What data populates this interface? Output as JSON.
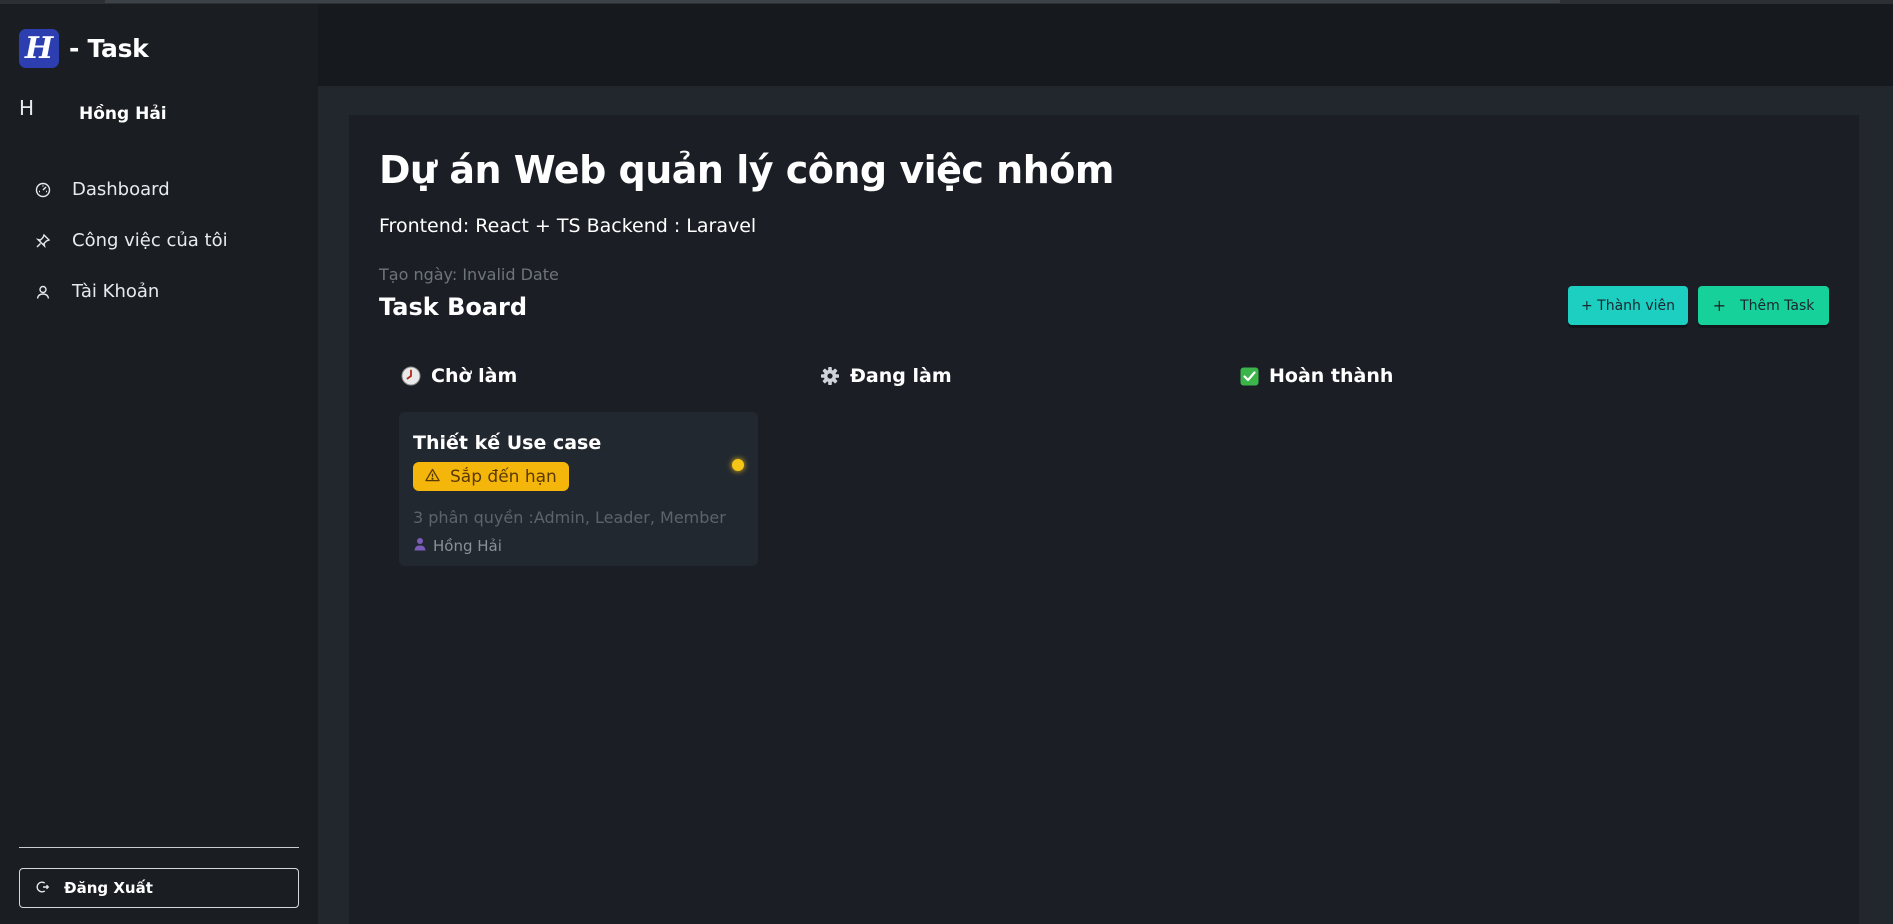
{
  "app": {
    "logo_letter": "H",
    "title": "- Task",
    "accent_color": "#2d3fb0"
  },
  "user": {
    "initial": "H",
    "name": "Hồng Hải"
  },
  "sidebar": {
    "items": [
      {
        "label": "Dashboard",
        "icon": "gauge-icon"
      },
      {
        "label": "Công việc của tôi",
        "icon": "pin-icon"
      },
      {
        "label": "Tài Khoản",
        "icon": "user-icon"
      }
    ],
    "logout_label": "Đăng Xuất",
    "logout_icon": "logout-icon"
  },
  "project": {
    "title": "Dự án Web quản lý công việc nhóm",
    "description": "Frontend: React + TS Backend : Laravel",
    "created": "Tạo ngày: Invalid Date"
  },
  "board": {
    "title": "Task Board",
    "add_member_label": "+ Thành viên",
    "add_task_label": "Thêm Task",
    "add_task_icon": "+",
    "member_button_color": "#1ccfc0",
    "task_button_color": "#17d19a",
    "columns": [
      {
        "title": "Chờ làm",
        "icon": "clock-icon"
      },
      {
        "title": "Đang làm",
        "icon": "gear-icon"
      },
      {
        "title": "Hoàn thành",
        "icon": "check-box-icon"
      }
    ],
    "cards": [
      {
        "column": "Chờ làm",
        "title": "Thiết kế Use case",
        "badge": "Sắp đến hạn",
        "badge_icon": "warning-icon",
        "badge_color": "#f5b60c",
        "meta": "3 phân quyền :Admin, Leader, Member",
        "assignee": "Hồng Hải",
        "assignee_icon": "person-icon",
        "status_dot_color": "#f5c518"
      }
    ]
  }
}
